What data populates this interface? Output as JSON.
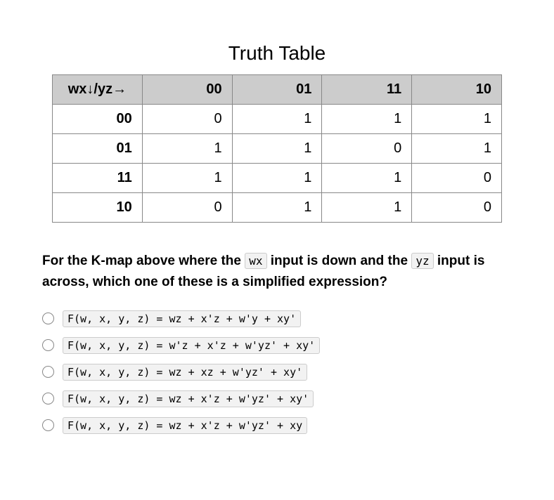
{
  "title": "Truth Table",
  "table": {
    "corner": "wx↓/yz→",
    "col_headers": [
      "00",
      "01",
      "11",
      "10"
    ],
    "row_headers": [
      "00",
      "01",
      "11",
      "10"
    ],
    "cells": [
      [
        "0",
        "1",
        "1",
        "1"
      ],
      [
        "1",
        "1",
        "0",
        "1"
      ],
      [
        "1",
        "1",
        "1",
        "0"
      ],
      [
        "0",
        "1",
        "1",
        "0"
      ]
    ]
  },
  "question": {
    "part1": "For the K-map above where the ",
    "tag1": "wx",
    "part2": " input is down and the ",
    "tag2": "yz",
    "part3": " input is across, which one of these is a simplified expression?"
  },
  "options": [
    "F(w, x, y, z) = wz + x'z + w'y + xy'",
    "F(w, x, y, z) = w'z + x'z + w'yz' + xy'",
    "F(w, x, y, z) = wz + xz + w'yz' + xy'",
    "F(w, x, y, z) = wz + x'z + w'yz' + xy'",
    "F(w, x, y, z) = wz + x'z + w'yz' + xy"
  ],
  "chart_data": {
    "type": "table",
    "title": "Truth Table",
    "columns": [
      "wx↓/yz→",
      "00",
      "01",
      "11",
      "10"
    ],
    "rows": [
      [
        "00",
        0,
        1,
        1,
        1
      ],
      [
        "01",
        1,
        1,
        0,
        1
      ],
      [
        "11",
        1,
        1,
        1,
        0
      ],
      [
        "10",
        0,
        1,
        1,
        0
      ]
    ]
  }
}
